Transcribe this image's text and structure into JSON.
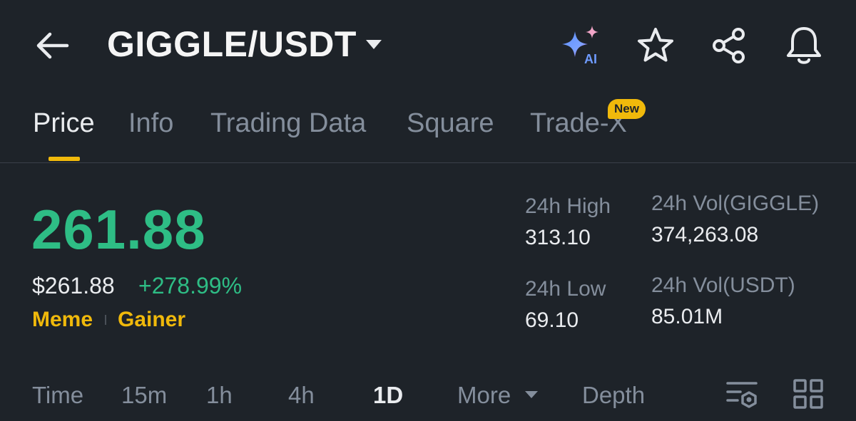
{
  "header": {
    "pair": "GIGGLE/USDT",
    "ai_badge": "AI",
    "icons": [
      "back-arrow-icon",
      "caret-down-icon",
      "ai-sparkle-icon",
      "star-icon",
      "share-icon",
      "bell-icon"
    ]
  },
  "tabs": [
    {
      "label": "Price",
      "active": true
    },
    {
      "label": "Info",
      "active": false
    },
    {
      "label": "Trading Data",
      "active": false
    },
    {
      "label": "Square",
      "active": false
    },
    {
      "label": "Trade-X",
      "active": false,
      "badge": "New"
    }
  ],
  "price": {
    "last": "261.88",
    "usd": "$261.88",
    "change": "+278.99%",
    "tags": [
      "Meme",
      "Gainer"
    ]
  },
  "stats": {
    "high_label": "24h High",
    "high_value": "313.10",
    "low_label": "24h Low",
    "low_value": "69.10",
    "vol_base_label": "24h Vol(GIGGLE)",
    "vol_base_value": "374,263.08",
    "vol_quote_label": "24h Vol(USDT)",
    "vol_quote_value": "85.01M"
  },
  "intervals": {
    "time": "Time",
    "m15": "15m",
    "h1": "1h",
    "h4": "4h",
    "d1": "1D",
    "more": "More",
    "depth": "Depth",
    "selected": "1D"
  },
  "colors": {
    "background": "#1e2329",
    "positive": "#2ebd85",
    "accent": "#f0b90b",
    "muted": "#848e9c",
    "text": "#eaecef"
  }
}
